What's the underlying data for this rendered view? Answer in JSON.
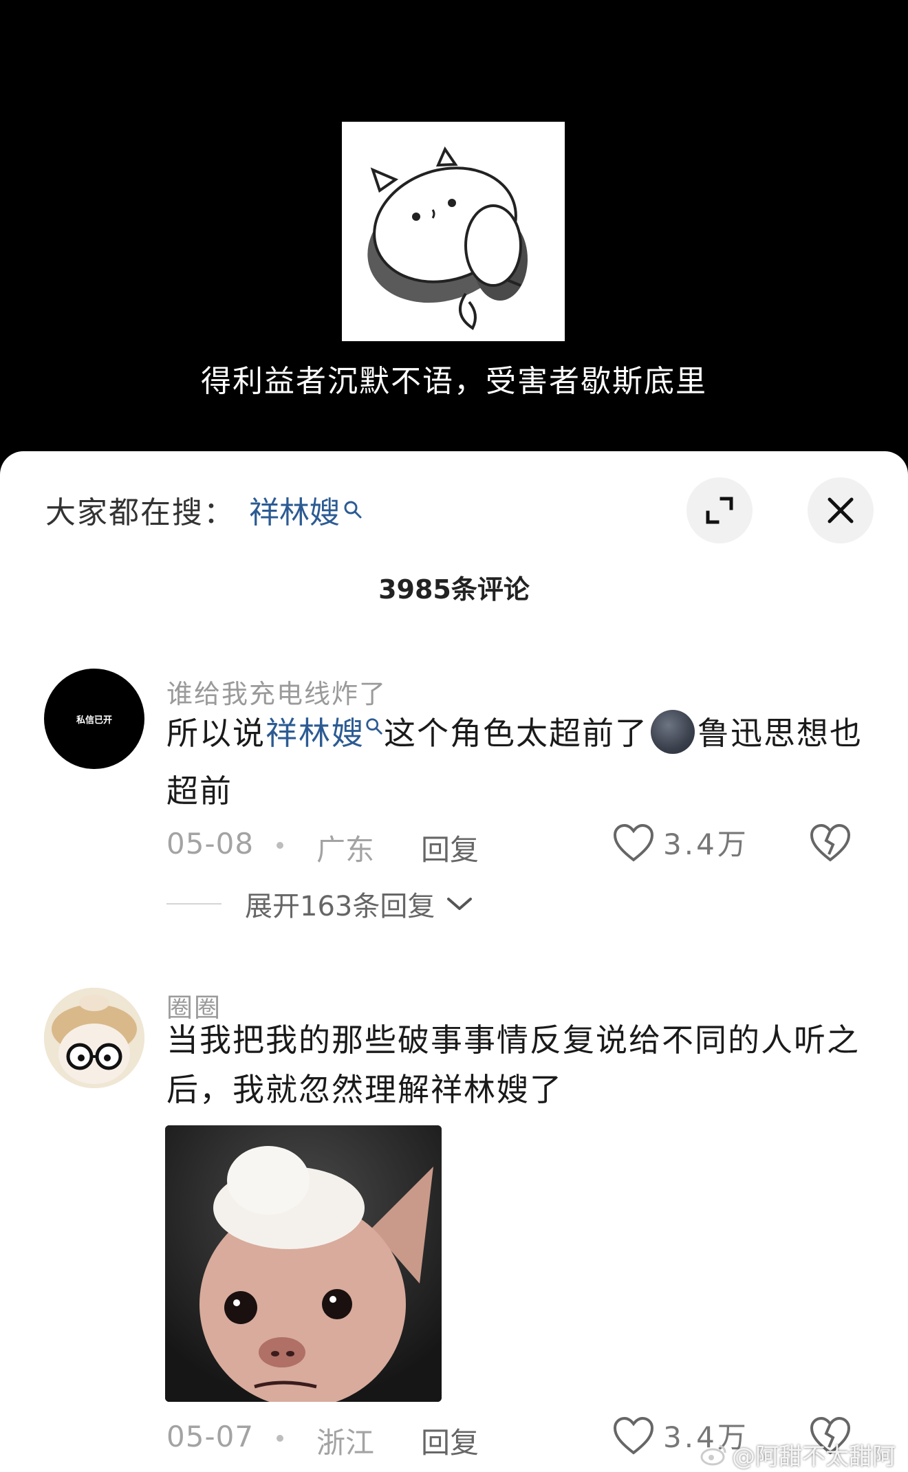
{
  "video": {
    "caption": "得利益者沉默不语，受害者歇斯底里",
    "sticker_icon": "cat-sticker-image"
  },
  "sheet": {
    "search_label": "大家都在搜：",
    "search_term": "祥林嫂",
    "comment_count": "3985条评论",
    "colors": {
      "link": "#2c5b93",
      "text": "#1a1a1a",
      "meta": "#a3a3a3"
    }
  },
  "comments": [
    {
      "avatar_text": "私信已开",
      "username": "谁给我充电线炸了",
      "text_before": "所以说",
      "highlight": "祥林嫂",
      "text_middle": "这个角色太超前了",
      "emoji": "new-moon-face-emoji",
      "text_after": "鲁迅思想也超前",
      "date": "05-08",
      "region": "广东",
      "reply_label": "回复",
      "likes": "3.4万",
      "expand_replies": "展开163条回复"
    },
    {
      "username": "圈圈",
      "text": "当我把我的那些破事事情反复说给不同的人听之后，我就忽然理解祥林嫂了",
      "image": "hairless-dog-meme-image",
      "date": "05-07",
      "region": "浙江",
      "reply_label": "回复",
      "likes": "3.4万"
    }
  ],
  "watermark": "@阿甜不太甜阿"
}
